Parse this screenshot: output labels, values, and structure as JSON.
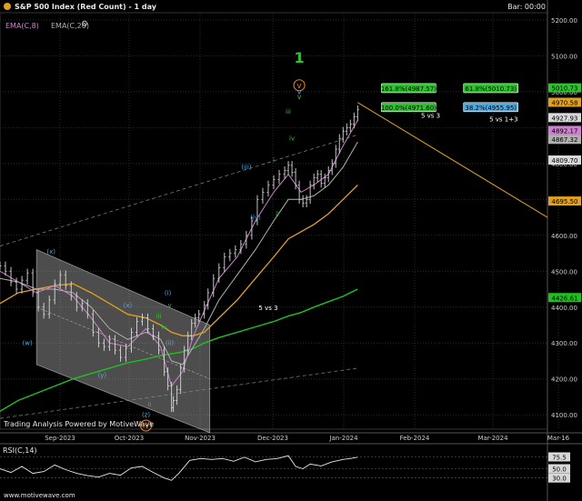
{
  "header": {
    "title": "S&P 500 Index (Red Count) - 1 day",
    "bar_label": "Bar: 00:00",
    "ema1": "EMA(C,8)",
    "ema2": "EMA(C,20)",
    "footer": "Trading Analysis Powered by MotiveWave",
    "watermark": "www.motivewave.com"
  },
  "colors": {
    "background": "#000000",
    "grid": "#2a2a2a",
    "price": "#d8d8d8",
    "ema8": "#d080d0",
    "ema20": "#b0b0b0",
    "ema50": "#e0a020",
    "ema200": "#20c020",
    "projection": "#e0a020",
    "label_green": "#30c030",
    "label_blue": "#4fa8e0",
    "label_orange": "#e08020"
  },
  "chart_data": {
    "type": "line",
    "title": "S&P 500 Index (Red Count) - 1 day",
    "x_ticks": [
      "Sep-2023",
      "Oct-2023",
      "Nov-2023",
      "Dec-2023",
      "Jan-2024",
      "Feb-2024",
      "Mar-2024",
      "Mar-16"
    ],
    "y_ticks": [
      4100,
      4200,
      4300,
      4400,
      4500,
      4600,
      4700,
      4800,
      4900,
      5000,
      5100,
      5200
    ],
    "ylim": [
      4060,
      5220
    ],
    "price": [
      [
        0,
        4515
      ],
      [
        3,
        4500
      ],
      [
        6,
        4470
      ],
      [
        9,
        4450
      ],
      [
        12,
        4475
      ],
      [
        15,
        4495
      ],
      [
        18,
        4440
      ],
      [
        21,
        4400
      ],
      [
        24,
        4380
      ],
      [
        27,
        4420
      ],
      [
        30,
        4465
      ],
      [
        33,
        4490
      ],
      [
        36,
        4460
      ],
      [
        39,
        4430
      ],
      [
        42,
        4400
      ],
      [
        45,
        4410
      ],
      [
        48,
        4380
      ],
      [
        51,
        4330
      ],
      [
        54,
        4300
      ],
      [
        57,
        4290
      ],
      [
        60,
        4310
      ],
      [
        63,
        4280
      ],
      [
        66,
        4260
      ],
      [
        69,
        4285
      ],
      [
        72,
        4330
      ],
      [
        75,
        4360
      ],
      [
        78,
        4370
      ],
      [
        81,
        4340
      ],
      [
        84,
        4320
      ],
      [
        87,
        4280
      ],
      [
        90,
        4220
      ],
      [
        92,
        4180
      ],
      [
        94,
        4120
      ],
      [
        95,
        4140
      ],
      [
        97,
        4170
      ],
      [
        99,
        4230
      ],
      [
        101,
        4280
      ],
      [
        103,
        4320
      ],
      [
        105,
        4355
      ],
      [
        107,
        4370
      ],
      [
        109,
        4380
      ],
      [
        112,
        4405
      ],
      [
        114,
        4440
      ],
      [
        117,
        4480
      ],
      [
        120,
        4510
      ],
      [
        123,
        4540
      ],
      [
        126,
        4550
      ],
      [
        129,
        4560
      ],
      [
        132,
        4575
      ],
      [
        135,
        4600
      ],
      [
        138,
        4640
      ],
      [
        141,
        4700
      ],
      [
        144,
        4720
      ],
      [
        147,
        4740
      ],
      [
        150,
        4755
      ],
      [
        153,
        4770
      ],
      [
        156,
        4780
      ],
      [
        158,
        4795
      ],
      [
        160,
        4775
      ],
      [
        162,
        4740
      ],
      [
        164,
        4700
      ],
      [
        166,
        4690
      ],
      [
        168,
        4700
      ],
      [
        170,
        4740
      ],
      [
        172,
        4760
      ],
      [
        174,
        4770
      ],
      [
        176,
        4745
      ],
      [
        178,
        4760
      ],
      [
        180,
        4780
      ],
      [
        182,
        4800
      ],
      [
        184,
        4840
      ],
      [
        186,
        4870
      ],
      [
        188,
        4890
      ],
      [
        190,
        4900
      ],
      [
        192,
        4910
      ],
      [
        194,
        4930
      ],
      [
        196,
        4950
      ]
    ],
    "ema8": [
      [
        0,
        4500
      ],
      [
        10,
        4470
      ],
      [
        20,
        4440
      ],
      [
        30,
        4460
      ],
      [
        40,
        4430
      ],
      [
        50,
        4370
      ],
      [
        60,
        4300
      ],
      [
        70,
        4290
      ],
      [
        80,
        4340
      ],
      [
        88,
        4290
      ],
      [
        94,
        4180
      ],
      [
        100,
        4220
      ],
      [
        106,
        4320
      ],
      [
        112,
        4390
      ],
      [
        120,
        4480
      ],
      [
        130,
        4540
      ],
      [
        140,
        4640
      ],
      [
        150,
        4720
      ],
      [
        158,
        4770
      ],
      [
        165,
        4720
      ],
      [
        172,
        4740
      ],
      [
        180,
        4770
      ],
      [
        188,
        4850
      ],
      [
        196,
        4920
      ]
    ],
    "ema20": [
      [
        0,
        4480
      ],
      [
        10,
        4470
      ],
      [
        20,
        4450
      ],
      [
        30,
        4450
      ],
      [
        40,
        4440
      ],
      [
        50,
        4400
      ],
      [
        60,
        4340
      ],
      [
        70,
        4310
      ],
      [
        80,
        4330
      ],
      [
        88,
        4310
      ],
      [
        94,
        4250
      ],
      [
        100,
        4240
      ],
      [
        106,
        4290
      ],
      [
        112,
        4340
      ],
      [
        120,
        4420
      ],
      [
        130,
        4490
      ],
      [
        140,
        4560
      ],
      [
        150,
        4640
      ],
      [
        158,
        4700
      ],
      [
        165,
        4700
      ],
      [
        172,
        4710
      ],
      [
        180,
        4740
      ],
      [
        188,
        4790
      ],
      [
        196,
        4860
      ]
    ],
    "ema50": [
      [
        0,
        4410
      ],
      [
        10,
        4440
      ],
      [
        20,
        4450
      ],
      [
        30,
        4460
      ],
      [
        40,
        4465
      ],
      [
        50,
        4440
      ],
      [
        60,
        4410
      ],
      [
        70,
        4380
      ],
      [
        80,
        4370
      ],
      [
        88,
        4350
      ],
      [
        94,
        4330
      ],
      [
        100,
        4320
      ],
      [
        106,
        4320
      ],
      [
        112,
        4330
      ],
      [
        120,
        4370
      ],
      [
        130,
        4420
      ],
      [
        140,
        4480
      ],
      [
        150,
        4540
      ],
      [
        158,
        4590
      ],
      [
        165,
        4610
      ],
      [
        172,
        4630
      ],
      [
        180,
        4660
      ],
      [
        188,
        4700
      ],
      [
        196,
        4740
      ]
    ],
    "ema200": [
      [
        0,
        4110
      ],
      [
        10,
        4140
      ],
      [
        20,
        4160
      ],
      [
        30,
        4180
      ],
      [
        40,
        4200
      ],
      [
        50,
        4215
      ],
      [
        60,
        4230
      ],
      [
        70,
        4245
      ],
      [
        80,
        4255
      ],
      [
        88,
        4265
      ],
      [
        94,
        4270
      ],
      [
        100,
        4275
      ],
      [
        106,
        4285
      ],
      [
        112,
        4300
      ],
      [
        120,
        4315
      ],
      [
        130,
        4330
      ],
      [
        140,
        4345
      ],
      [
        150,
        4360
      ],
      [
        158,
        4375
      ],
      [
        165,
        4385
      ],
      [
        172,
        4400
      ],
      [
        180,
        4415
      ],
      [
        188,
        4430
      ],
      [
        196,
        4450
      ]
    ],
    "channel_top": [
      [
        0,
        4570
      ],
      [
        196,
        4880
      ]
    ],
    "channel_bottom": [
      [
        0,
        4090
      ],
      [
        196,
        4230
      ]
    ],
    "projection": [
      [
        196,
        4970
      ],
      [
        300,
        4650
      ]
    ],
    "price_tags": [
      {
        "value": 5010.73,
        "label": "5010.73",
        "color": "#30c030"
      },
      {
        "value": 4970.58,
        "label": "4970.58",
        "color": "#e0a020"
      },
      {
        "value": 4927.93,
        "label": "4927.93",
        "color": "#d8d8d8"
      },
      {
        "value": 4892.17,
        "label": "4892.17",
        "color": "#d080d0"
      },
      {
        "value": 4867.32,
        "label": "4867.32",
        "color": "#b0b0b0"
      },
      {
        "value": 4809.7,
        "label": "4809.70",
        "color": "#d8d8d8"
      },
      {
        "value": 4695.5,
        "label": "4695.50",
        "color": "#e0a020"
      },
      {
        "value": 4426.61,
        "label": "4426.61",
        "color": "#20c020"
      }
    ],
    "fib_boxes": [
      {
        "text": "161.8%(4987.57)",
        "value": 5010,
        "color": "#30c030",
        "col": 0
      },
      {
        "text": "61.8%(5010.73)",
        "value": 5010,
        "color": "#30c030",
        "col": 1
      },
      {
        "text": "100.0%(4971.60)",
        "value": 4957,
        "color": "#30c030",
        "col": 0
      },
      {
        "text": "38.2%(4955.95)",
        "value": 4957,
        "color": "#4fa8e0",
        "col": 1
      }
    ],
    "fib_labels": [
      {
        "text": "5 vs 3",
        "value": 4935,
        "col": 0
      },
      {
        "text": "5 vs 1+3",
        "value": 4925,
        "col": 1
      },
      {
        "text": "5 vs 3",
        "value": 4400,
        "col": 2
      }
    ],
    "wave_labels": [
      {
        "text": "1",
        "x": 164,
        "value": 5095,
        "color": "#30c030",
        "size": 16,
        "shape": "none"
      },
      {
        "text": "v",
        "x": 164,
        "value": 5018,
        "color": "#e08020",
        "size": 9,
        "shape": "circle"
      },
      {
        "text": "v",
        "x": 164,
        "value": 5000,
        "color": "#4fa8e0",
        "size": 8,
        "shape": "none"
      },
      {
        "text": "v",
        "x": 164,
        "value": 4987,
        "color": "#30c030",
        "size": 8,
        "shape": "none"
      },
      {
        "text": "iii",
        "x": 158,
        "value": 4945,
        "color": "#30c030",
        "size": 7,
        "shape": "none"
      },
      {
        "text": "iv",
        "x": 160,
        "value": 4870,
        "color": "#30c030",
        "size": 7,
        "shape": "none"
      },
      {
        "text": "(iii)",
        "x": 135,
        "value": 4790,
        "color": "#4fa8e0",
        "size": 7,
        "shape": "none"
      },
      {
        "text": "(iv)",
        "x": 140,
        "value": 4650,
        "color": "#4fa8e0",
        "size": 7,
        "shape": "none"
      },
      {
        "text": "i",
        "x": 150,
        "value": 4810,
        "color": "#30c030",
        "size": 7,
        "shape": "none"
      },
      {
        "text": "ii",
        "x": 152,
        "value": 4660,
        "color": "#30c030",
        "size": 7,
        "shape": "none"
      },
      {
        "text": "(x)",
        "x": 28,
        "value": 4555,
        "color": "#4fa8e0",
        "size": 7,
        "shape": "none"
      },
      {
        "text": "(w)",
        "x": 15,
        "value": 4300,
        "color": "#4fa8e0",
        "size": 7,
        "shape": "none"
      },
      {
        "text": "(y)",
        "x": 56,
        "value": 4210,
        "color": "#4fa8e0",
        "size": 7,
        "shape": "none"
      },
      {
        "text": "(x)",
        "x": 70,
        "value": 4405,
        "color": "#4fa8e0",
        "size": 7,
        "shape": "none"
      },
      {
        "text": "(z)",
        "x": 80,
        "value": 4100,
        "color": "#4fa8e0",
        "size": 7,
        "shape": "none"
      },
      {
        "text": "iv",
        "x": 80,
        "value": 4070,
        "color": "#e08020",
        "size": 8,
        "shape": "circle"
      },
      {
        "text": "(i)",
        "x": 92,
        "value": 4440,
        "color": "#4fa8e0",
        "size": 7,
        "shape": "none"
      },
      {
        "text": "iii",
        "x": 87,
        "value": 4375,
        "color": "#30c030",
        "size": 7,
        "shape": "none"
      },
      {
        "text": "iv",
        "x": 90,
        "value": 4345,
        "color": "#30c030",
        "size": 7,
        "shape": "none"
      },
      {
        "text": "v",
        "x": 93,
        "value": 4405,
        "color": "#30c030",
        "size": 7,
        "shape": "none"
      },
      {
        "text": "(ii)",
        "x": 93,
        "value": 4300,
        "color": "#4fa8e0",
        "size": 7,
        "shape": "none"
      },
      {
        "text": "ii",
        "x": 82,
        "value": 4130,
        "color": "#30c030",
        "size": 7,
        "shape": "none"
      }
    ],
    "rsi": {
      "title": "RSI(C,14)",
      "ticks": [
        30,
        50,
        75
      ],
      "tags": [
        {
          "value": 75.5,
          "label": "75.5"
        },
        {
          "value": 50.0,
          "label": "50.0"
        },
        {
          "value": 30.0,
          "label": "30.0"
        }
      ],
      "values": [
        [
          0,
          50
        ],
        [
          6,
          42
        ],
        [
          12,
          55
        ],
        [
          18,
          40
        ],
        [
          24,
          44
        ],
        [
          30,
          58
        ],
        [
          36,
          48
        ],
        [
          42,
          40
        ],
        [
          48,
          35
        ],
        [
          54,
          32
        ],
        [
          60,
          40
        ],
        [
          66,
          36
        ],
        [
          72,
          52
        ],
        [
          78,
          55
        ],
        [
          84,
          42
        ],
        [
          90,
          30
        ],
        [
          94,
          25
        ],
        [
          98,
          40
        ],
        [
          104,
          68
        ],
        [
          110,
          72
        ],
        [
          116,
          70
        ],
        [
          122,
          72
        ],
        [
          128,
          66
        ],
        [
          134,
          75
        ],
        [
          140,
          65
        ],
        [
          146,
          70
        ],
        [
          152,
          72
        ],
        [
          158,
          78
        ],
        [
          162,
          55
        ],
        [
          166,
          50
        ],
        [
          170,
          60
        ],
        [
          176,
          56
        ],
        [
          182,
          65
        ],
        [
          188,
          70
        ],
        [
          192,
          72
        ],
        [
          196,
          75
        ]
      ]
    }
  }
}
